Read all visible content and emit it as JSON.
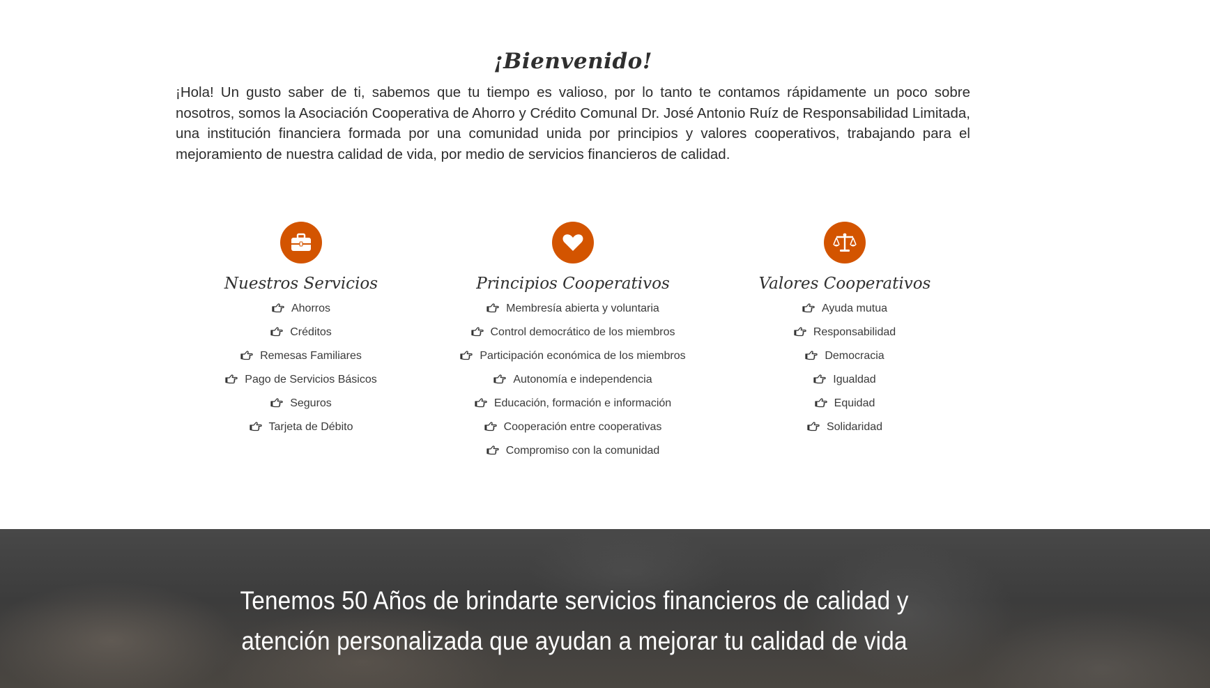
{
  "welcome": {
    "title": "¡Bienvenido!",
    "body": "¡Hola! Un gusto saber de ti, sabemos que tu tiempo es valioso, por lo tanto te contamos rápidamente un poco sobre nosotros, somos la Asociación Cooperativa de Ahorro y Crédito Comunal Dr. José Antonio Ruíz de Responsabilidad Limitada, una institución financiera formada por una comunidad unida por principios y valores cooperativos, trabajando para el mejoramiento de nuestra calidad de vida, por medio de servicios financieros de calidad."
  },
  "columns": [
    {
      "icon": "briefcase-icon",
      "title": "Nuestros Servicios",
      "items": [
        "Ahorros",
        "Créditos",
        "Remesas Familiares",
        "Pago de Servicios Básicos",
        "Seguros",
        "Tarjeta de Débito"
      ]
    },
    {
      "icon": "heart-icon",
      "title": "Principios Cooperativos",
      "items": [
        "Membresía abierta y voluntaria",
        "Control democrático de los miembros",
        "Participación económica de los miembros",
        "Autonomía e independencia",
        "Educación, formación e información",
        "Cooperación entre cooperativas",
        "Compromiso con la comunidad"
      ]
    },
    {
      "icon": "balance-scale-icon",
      "title": "Valores Cooperativos",
      "items": [
        "Ayuda mutua",
        "Responsabilidad",
        "Democracia",
        "Igualdad",
        "Equidad",
        "Solidaridad"
      ]
    }
  ],
  "banner": {
    "text": "Tenemos 50 Años de brindarte servicios financieros de calidad y atención personalizada que ayudan a mejorar tu calidad de vida"
  },
  "colors": {
    "accent": "#d35400",
    "text": "#333333",
    "banner_text": "#ffffff"
  }
}
